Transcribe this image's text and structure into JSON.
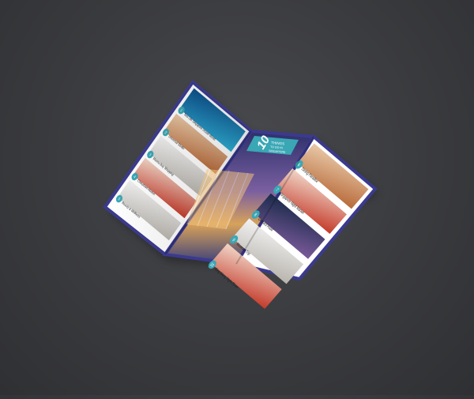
{
  "scene": {
    "background_color": "#3b3c3f",
    "brochure_border_color": "#3b3a8f",
    "accent_color": "#3aa7b5"
  },
  "brochure": {
    "cover": {
      "badge_number": "10",
      "badge_text_line1": "THINGS",
      "badge_text_line2": "TO DO IN",
      "badge_text_line3": "SINGAPORE"
    },
    "left_panel": {
      "items": [
        {
          "num": "1",
          "title": "Sea Life Singapore Ocean World"
        },
        {
          "num": "2",
          "title": "Universal Studio"
        },
        {
          "num": "3",
          "title": "Marina Bay Shopping"
        },
        {
          "num": "4",
          "title": "Chinatown Market"
        },
        {
          "num": "5",
          "title": "Beauty & Wellness"
        }
      ]
    },
    "right_panel": {
      "items": [
        {
          "num": "6",
          "title": "Dining Paradise"
        },
        {
          "num": "7",
          "title": "Singapore Night Market"
        },
        {
          "num": "8",
          "title": "Orchard Road"
        },
        {
          "num": "9",
          "title": "Museum Trip"
        },
        {
          "num": "10",
          "title": "Sing Along Night Show"
        }
      ]
    }
  }
}
